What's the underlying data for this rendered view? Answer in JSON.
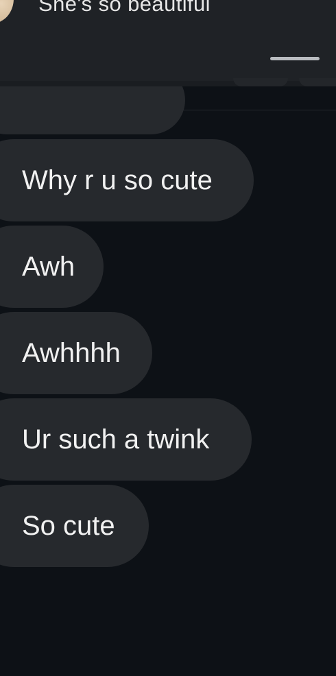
{
  "notification": {
    "preview_text": "She's so beautiful"
  },
  "messages": [
    {
      "text": "Why r u so cute"
    },
    {
      "text": "Awh"
    },
    {
      "text": "Awhhhh"
    },
    {
      "text": "Ur such a twink"
    },
    {
      "text": "So cute"
    }
  ],
  "colors": {
    "background": "#0d1116",
    "panel": "#1f2226",
    "bubble": "#26292d",
    "text": "#f1f1f1",
    "handle": "#b9bcc0"
  }
}
